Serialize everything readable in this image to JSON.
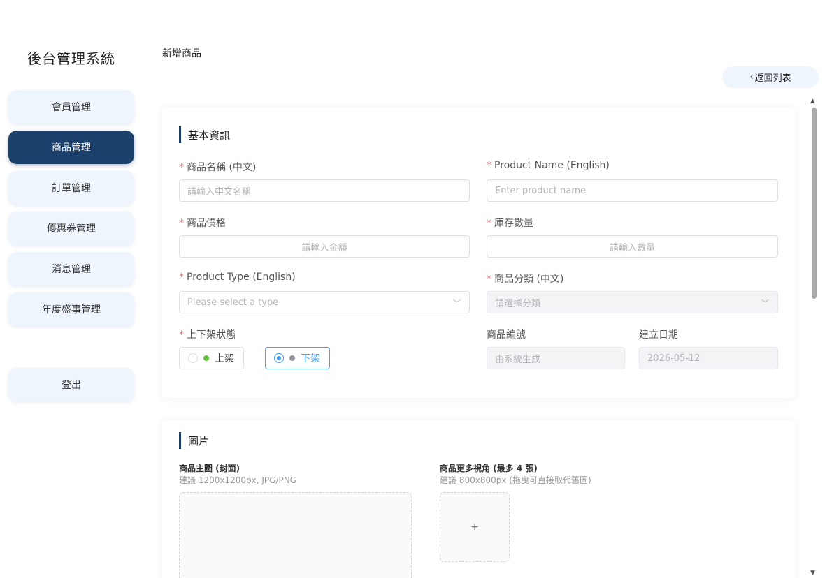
{
  "sidebar": {
    "brand": "後台管理系統",
    "items": [
      {
        "label": "會員管理"
      },
      {
        "label": "商品管理",
        "active": true
      },
      {
        "label": "訂單管理"
      },
      {
        "label": "優惠券管理"
      },
      {
        "label": "消息管理"
      },
      {
        "label": "年度盛事管理"
      }
    ],
    "logout": "登出"
  },
  "header": {
    "title": "新增商品",
    "back_icon": "chevron-left-icon",
    "back_label": "返回列表"
  },
  "basic": {
    "title": "基本資訊",
    "required_mark": "*",
    "name_zh": {
      "label": "商品名稱 (中文)",
      "placeholder": "請輸入中文名稱"
    },
    "name_en": {
      "label": "Product Name (English)",
      "placeholder": "Enter product name"
    },
    "price": {
      "label": "商品價格",
      "placeholder": "請輸入金額"
    },
    "stock": {
      "label": "庫存數量",
      "placeholder": "請輸入數量"
    },
    "type_en": {
      "label": "Product Type (English)",
      "placeholder": "Please select a type"
    },
    "category_zh": {
      "label": "商品分類 (中文)",
      "placeholder": "請選擇分類"
    },
    "status": {
      "label": "上下架狀態",
      "options": [
        {
          "label": "上架",
          "dot_color": "#67c23a",
          "checked": false
        },
        {
          "label": "下架",
          "dot_color": "#909399",
          "checked": true
        }
      ]
    },
    "product_no": {
      "label": "商品編號",
      "value": "由系統生成"
    },
    "created": {
      "label": "建立日期",
      "value": "2026-05-12"
    }
  },
  "images": {
    "title": "圖片",
    "main": {
      "label": "商品主圖 (封面)",
      "hint": "建議 1200x1200px, JPG/PNG"
    },
    "more": {
      "label": "商品更多視角 (最多 4 張)",
      "hint": "建議 800x800px (拖曳可直接取代舊圖)",
      "add": "+"
    }
  },
  "colors": {
    "accent": "#1b3f6b",
    "required": "#f56c6c",
    "primary": "#409eff"
  }
}
